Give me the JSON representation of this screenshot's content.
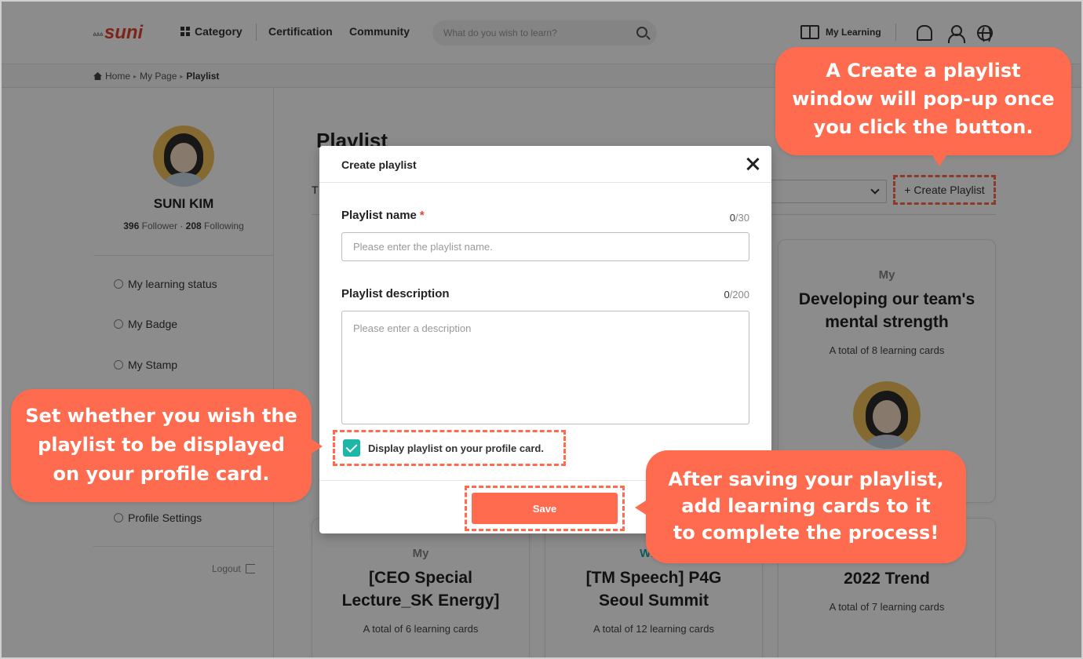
{
  "header": {
    "logo_ticks": "ᐞᐞᐞ",
    "logo_text": "suni",
    "nav_category": "Category",
    "nav_certification": "Certification",
    "nav_community": "Community",
    "search_placeholder": "What do you wish to learn?",
    "my_learning": "My Learning"
  },
  "breadcrumb": {
    "home": "Home",
    "arrow": "▸",
    "my_page": "My Page",
    "current": "Playlist"
  },
  "profile": {
    "name": "SUNI KIM",
    "followers": "396",
    "followers_label": "Follower",
    "dot": "·",
    "following": "208",
    "following_label": "Following"
  },
  "sidebar": {
    "items": [
      {
        "label": "My learning status",
        "icon": "pie-chart-icon"
      },
      {
        "label": "My Badge",
        "icon": "badge-icon"
      },
      {
        "label": "My Stamp",
        "icon": "stamp-icon"
      },
      {
        "label": "Profile Settings",
        "icon": "person-gear-icon"
      }
    ],
    "logout": "Logout"
  },
  "main": {
    "title": "Playlist",
    "tab_partial": "T",
    "create_button": "+ Create Playlist",
    "cards": [
      {
        "tag": "My",
        "title_line1": "Developing our team's",
        "title_line2": "mental strength",
        "count": "A total of 8 learning cards"
      },
      {
        "tag": "My",
        "title_line1": "[CEO Special",
        "title_line2": "Lecture_SK Energy]",
        "count": "A total of 6 learning cards"
      },
      {
        "tag": "Wish",
        "title_line1": "[TM Speech] P4G",
        "title_line2": "Seoul Summit",
        "count": "A total of 12 learning cards"
      },
      {
        "tag": "",
        "title_line1": "2022 Trend",
        "title_line2": "",
        "count": "A total of 7  learning cards"
      }
    ]
  },
  "modal": {
    "title": "Create playlist",
    "name_label": "Playlist name",
    "required_mark": "*",
    "name_count": "0",
    "name_max": "/30",
    "name_placeholder": "Please enter the playlist name.",
    "desc_label": "Playlist description",
    "desc_count": "0",
    "desc_max": "/200",
    "desc_placeholder": "Please enter a description",
    "display_checkbox_label": "Display playlist on your profile card.",
    "display_checked": true,
    "save_label": "Save"
  },
  "callouts": {
    "top_line1": "A Create a playlist",
    "top_line2": "window will pop-up once",
    "top_line3": "you click the button.",
    "left_line1": "Set whether you wish the",
    "left_line2": "playlist to be displayed",
    "left_line3": "on your profile card.",
    "right_line1": "After saving your playlist,",
    "right_line2": "add learning cards to it",
    "right_line3": "to complete the process!"
  },
  "colors": {
    "accent": "#ff6b4e",
    "brand": "#e8412c",
    "checkbox": "#1db7a8",
    "wish_tag": "#1fa3a7"
  }
}
